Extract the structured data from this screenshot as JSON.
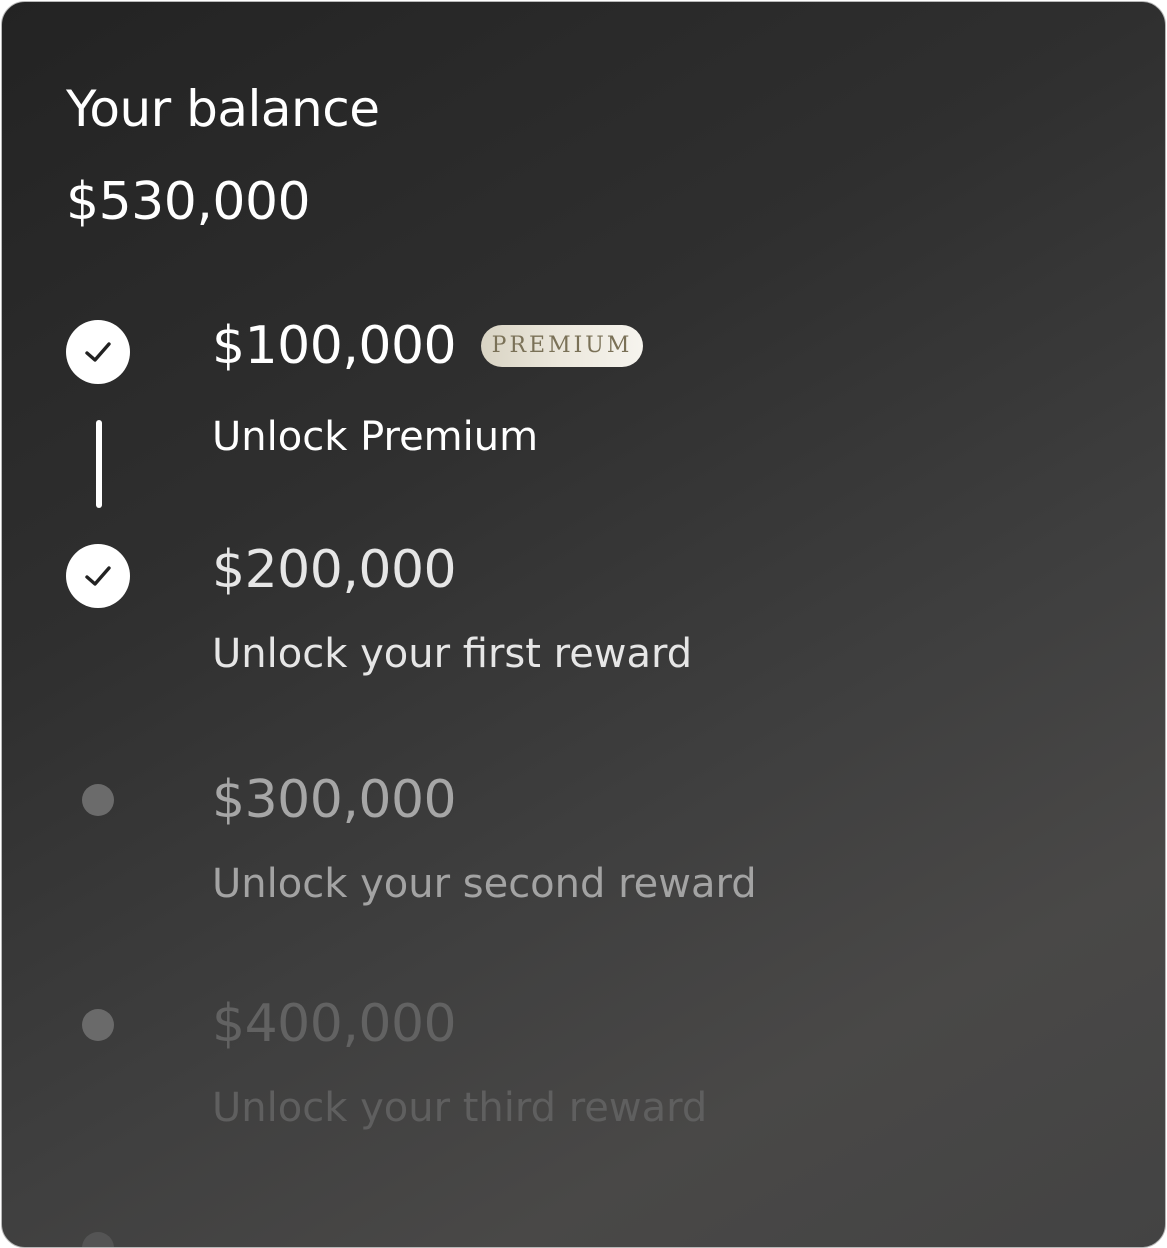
{
  "card": {
    "title": "Your balance",
    "balance": "$530,000"
  },
  "milestones": [
    {
      "amount": "$100,000",
      "description": "Unlock Premium",
      "badge": "PREMIUM",
      "status": "completed",
      "icon": "check-circle-icon"
    },
    {
      "amount": "$200,000",
      "description": "Unlock your first reward",
      "status": "completed",
      "icon": "check-circle-icon"
    },
    {
      "amount": "$300,000",
      "description": "Unlock your second reward",
      "status": "locked",
      "icon": "dot-icon"
    },
    {
      "amount": "$400,000",
      "description": "Unlock your third reward",
      "status": "locked",
      "icon": "dot-icon"
    }
  ],
  "colors": {
    "card_background_start": "#232323",
    "card_background_end": "#494847",
    "text_primary": "#ffffff",
    "badge_background": "#ece8dd",
    "badge_text": "#7a7157"
  }
}
